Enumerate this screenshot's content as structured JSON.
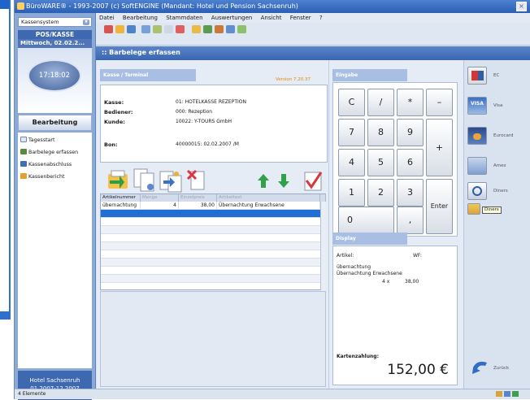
{
  "window": {
    "title": "BüroWARE® - 1993-2007 (c) SoftENGINE  (Mandant: Hotel und Pension Sachsenruh)",
    "close_glyph": "×"
  },
  "menu": [
    "Datei",
    "Bearbeitung",
    "Stammdaten",
    "Auswertungen",
    "Ansicht",
    "Fenster",
    "?"
  ],
  "sidebar": {
    "system_select": "Kassensystem",
    "pos_title": "POS/KASSE",
    "date": "Mittwoch, 02.02.2...",
    "clock": "17:18:02",
    "section_title": "Bearbeitung",
    "items": [
      {
        "label": "Tagesstart",
        "icon": "calendar-icon"
      },
      {
        "label": "Barbelege erfassen",
        "icon": "receipt-icon"
      },
      {
        "label": "Kassenabschluss",
        "icon": "register-close-icon"
      },
      {
        "label": "Kassenbericht",
        "icon": "report-icon"
      }
    ],
    "footer_line1": "Hotel Sachsenruh",
    "footer_line2": "01.2007-12.2007"
  },
  "main": {
    "header": ":: Barbelege erfassen",
    "kasse_tab": "Kasse / Terminal",
    "version": "Version 7.20.37",
    "info": {
      "kasse_label": "Kasse:",
      "kasse_value": "01: HOTELKASSE REZEPTION",
      "bediener_label": "Bediener:",
      "bediener_value": "000: Rezeption",
      "kunde_label": "Kunde:",
      "kunde_value": "10022: Y-TOURS GmbH",
      "bon_label": "Bon:",
      "bon_value": "40000015: 02.02.2007 /M"
    },
    "grid": {
      "headers": [
        "Artikelnummer",
        "Menge",
        "Einzelpreis",
        "Artikeltext"
      ],
      "rows": [
        {
          "artikelnummer": "übernachtung",
          "menge": "4",
          "einzelpreis": "38,00",
          "artikeltext": "Übernachtung Erwachsene"
        }
      ]
    }
  },
  "pad": {
    "eingabe_tab": "Eingabe",
    "keys": {
      "c": "C",
      "div": "/",
      "mul": "*",
      "minus": "–",
      "k7": "7",
      "k8": "8",
      "k9": "9",
      "plus": "+",
      "k4": "4",
      "k5": "5",
      "k6": "6",
      "k1": "1",
      "k2": "2",
      "k3": "3",
      "enter": "Enter",
      "k0": "0",
      "comma": ","
    },
    "display_tab": "Display",
    "display": {
      "artikel_label": "Artikel:",
      "wf_label": "WF:",
      "line1": "übernachtung",
      "line2": "Übernachtung Erwachsene",
      "qty_line": "4 x",
      "price_line": "38,00",
      "kartenzahlung": "Kartenzahlung:",
      "total": "152,00 €"
    }
  },
  "payment": {
    "methods": [
      {
        "label": "EC",
        "icon": "ec-card-icon"
      },
      {
        "label": "Visa",
        "icon": "visa-card-icon"
      },
      {
        "label": "Eurocard",
        "icon": "eurocard-icon"
      },
      {
        "label": "Amex",
        "icon": "amex-card-icon"
      },
      {
        "label": "Diners",
        "icon": "diners-card-icon"
      }
    ],
    "tooltip": "Diners",
    "back_label": "Zurück"
  },
  "status": {
    "elements": "4 Elemente"
  },
  "colors": {
    "accent": "#3e68b0",
    "header": "#4a76c0",
    "arrow_green": "#2ea14a"
  }
}
